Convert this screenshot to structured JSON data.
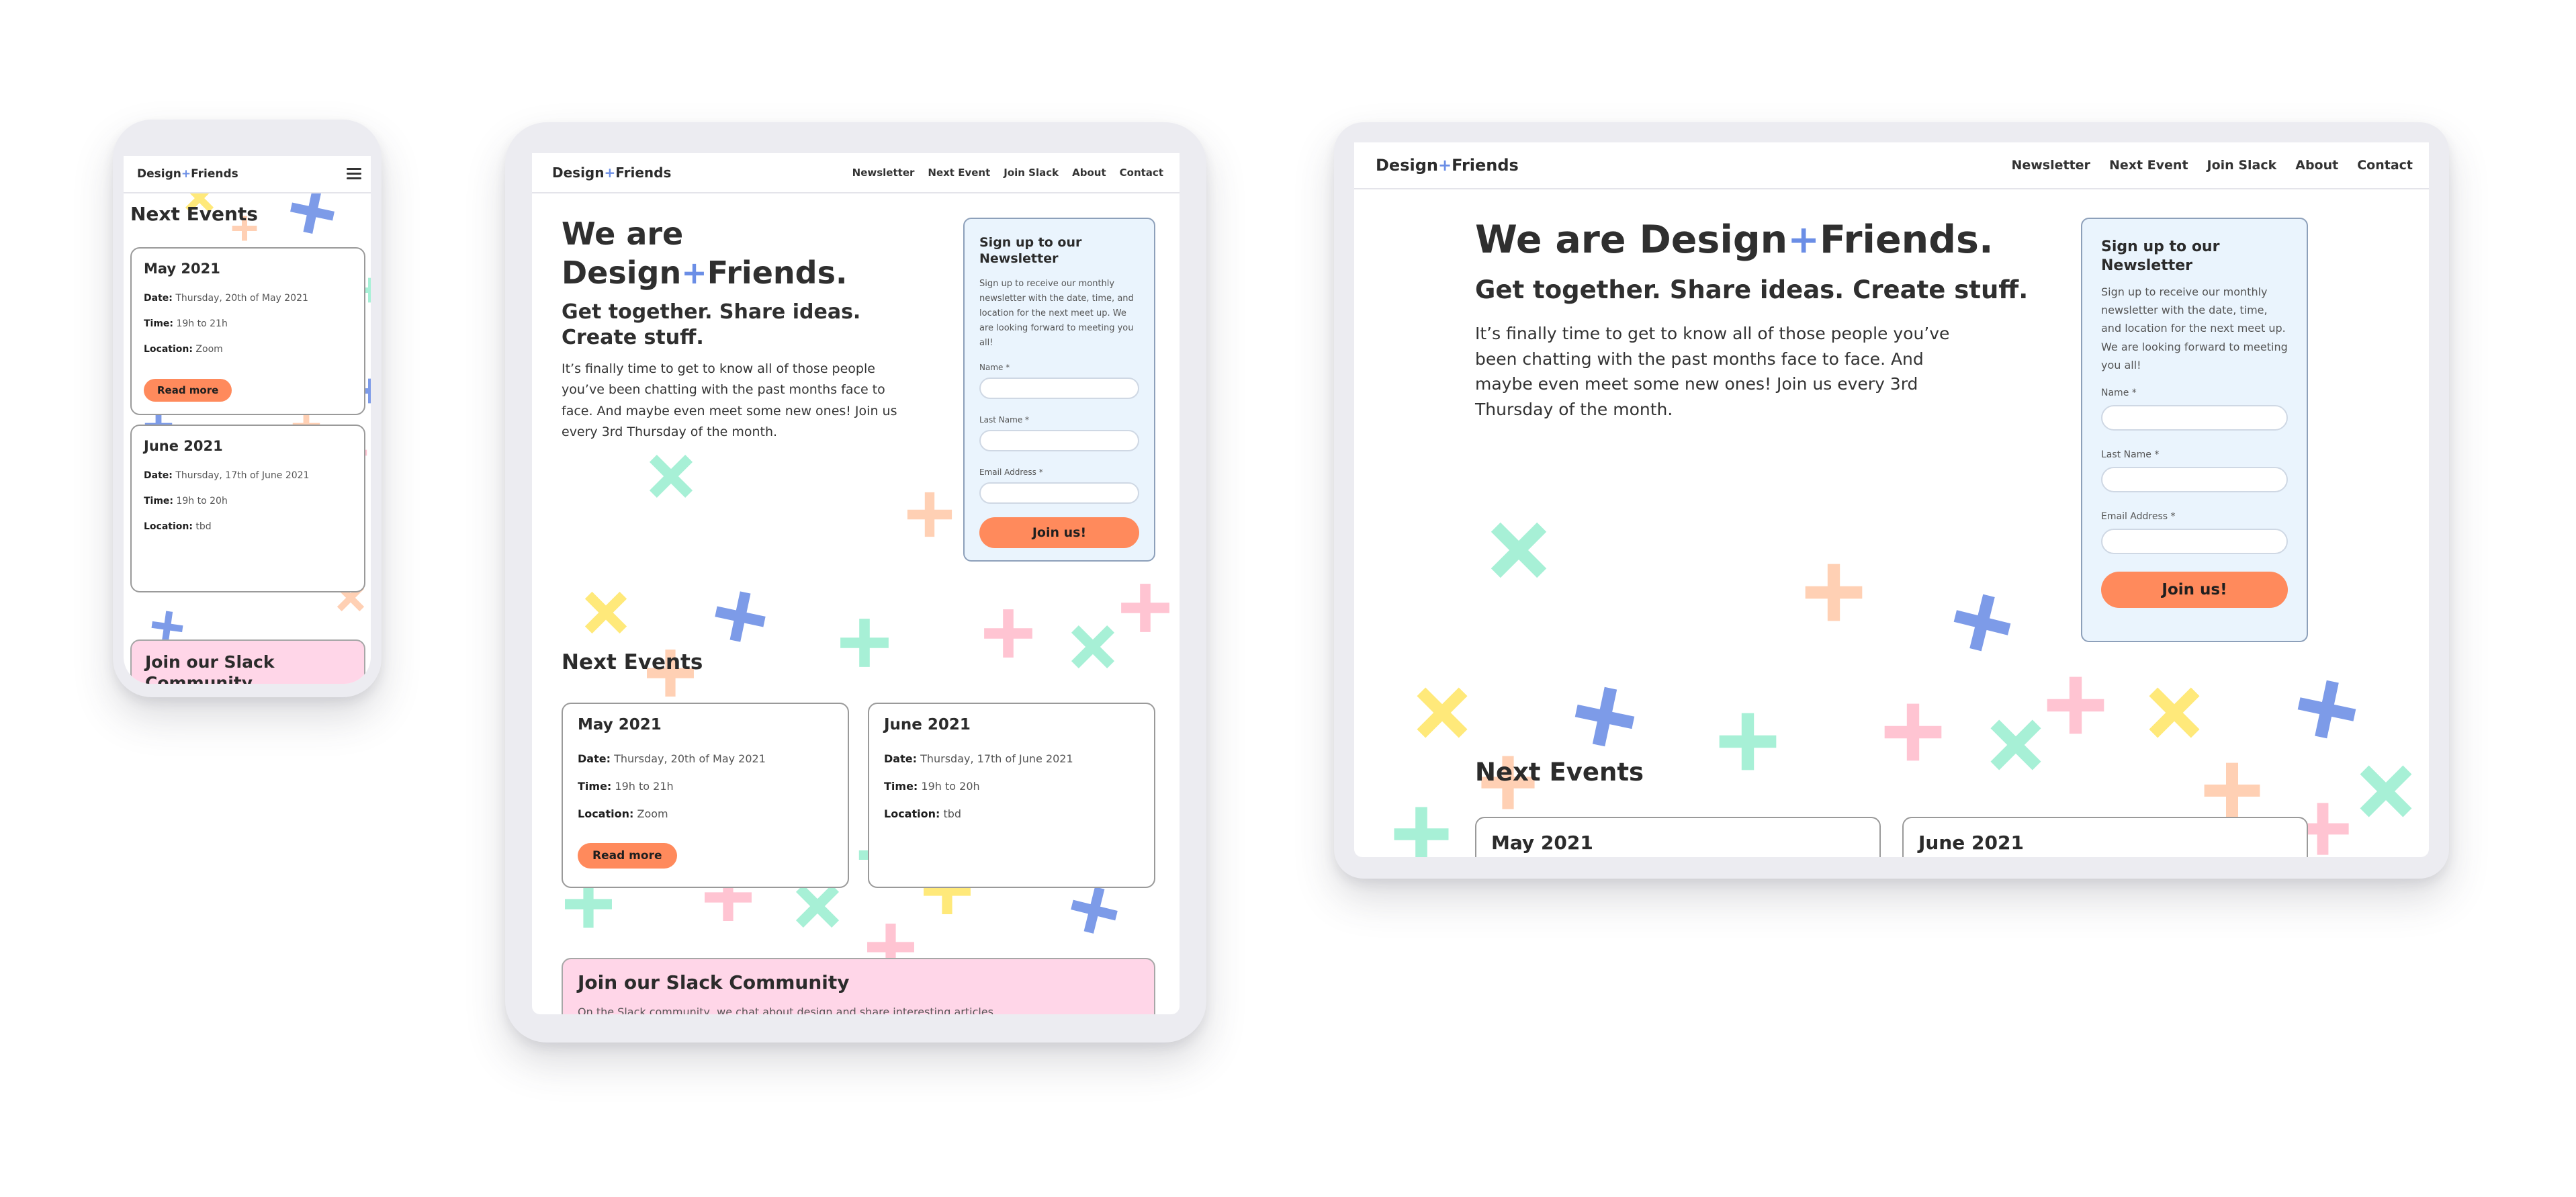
{
  "site": {
    "logo_a": "Design",
    "logo_plus": "+",
    "logo_b": "Friends",
    "nav": [
      "Newsletter",
      "Next Event",
      "Join Slack",
      "About",
      "Contact"
    ]
  },
  "hero": {
    "title_a": "We are",
    "title_b": "Design",
    "title_plus": "+",
    "title_c": "Friends.",
    "tagline": "Get together. Share ideas. Create stuff.",
    "intro": "It’s finally time to get to know all of those people you’ve been chatting with the past months face to face. And maybe even meet some new ones! Join us every 3rd Thursday of the month."
  },
  "newsletter": {
    "title": "Sign up to our Newsletter",
    "text": "Sign up to receive our monthly newsletter with the date, time, and location for the next meet up. We are looking forward to meeting you all!",
    "name_label": "Name *",
    "lastname_label": "Last Name *",
    "email_label": "Email Address *",
    "button": "Join us!"
  },
  "events": {
    "title": "Next Events",
    "date_label": "Date:",
    "time_label": "Time:",
    "location_label": "Location:",
    "items": [
      {
        "title": "May 2021",
        "date": "Thursday, 20th of May 2021",
        "time": "19h to 21h",
        "location": "Zoom",
        "button": "Read more"
      },
      {
        "title": "June 2021",
        "date": "Thursday, 17th of June 2021",
        "time": "19h to 20h",
        "location": "tbd"
      }
    ]
  },
  "slack": {
    "title": "Join our Slack Community",
    "text": "On the Slack community, we chat about design and share interesting articles."
  },
  "colors": {
    "accent": "#6b8ee6",
    "button": "#ff8a5c",
    "signup_bg": "#eaf4fd",
    "slack_bg": "#ffd6e8",
    "mark_blue": "#7d9be8",
    "mark_yellow": "#ffe97a",
    "mark_mint": "#a7f0d6",
    "mark_pink": "#ffc4d2",
    "mark_peach": "#ffd0b4"
  },
  "icons": [
    "menu-icon",
    "plus-mark-icon",
    "cross-mark-icon"
  ]
}
